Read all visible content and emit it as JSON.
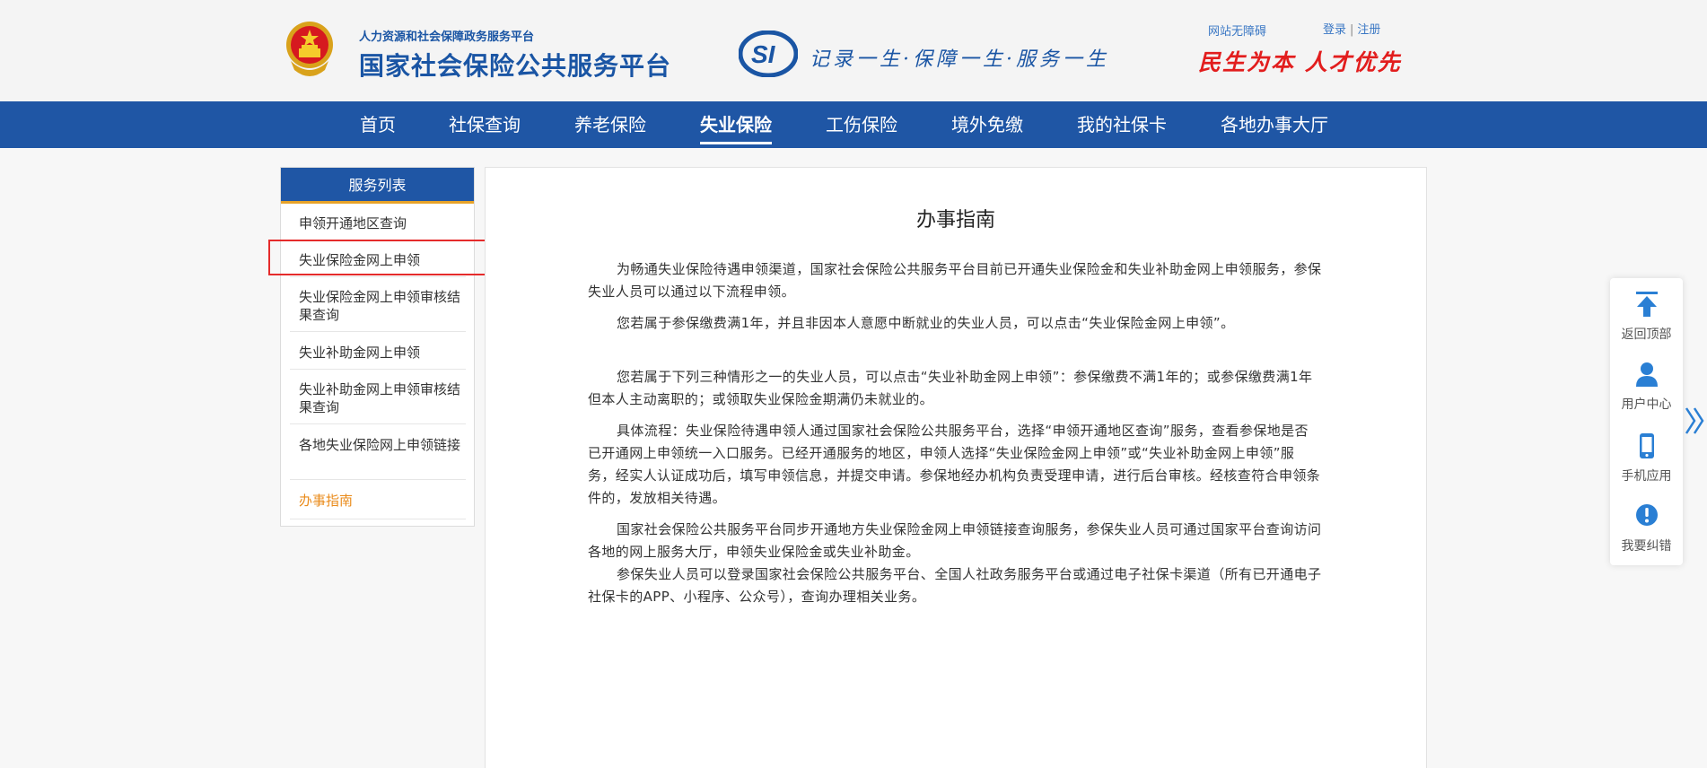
{
  "header": {
    "sub_title": "人力资源和社会保障政务服务平台",
    "title": "国家社会保险公共服务平台",
    "slogan": "记录一生·保障一生·服务一生",
    "motto": "民生为本 人才优先",
    "accessibility": "网站无障碍",
    "login": "登录",
    "separator": "|",
    "register": "注册"
  },
  "nav": {
    "items": [
      {
        "label": "首页"
      },
      {
        "label": "社保查询"
      },
      {
        "label": "养老保险"
      },
      {
        "label": "失业保险"
      },
      {
        "label": "工伤保险"
      },
      {
        "label": "境外免缴"
      },
      {
        "label": "我的社保卡"
      },
      {
        "label": "各地办事大厅"
      }
    ],
    "active": "失业保险"
  },
  "sidebar": {
    "title": "服务列表",
    "items": [
      {
        "label": "申领开通地区查询"
      },
      {
        "label": "失业保险金网上申领"
      },
      {
        "label": "失业保险金网上申领审核结果查询"
      },
      {
        "label": "失业补助金网上申领"
      },
      {
        "label": "失业补助金网上申领审核结果查询"
      },
      {
        "label": "各地失业保险网上申领链接"
      },
      {
        "label": "办事指南"
      }
    ],
    "current": "办事指南"
  },
  "main": {
    "title": "办事指南",
    "paragraphs": [
      "为畅通失业保险待遇申领渠道，国家社会保险公共服务平台目前已开通失业保险金和失业补助金网上申领服务，参保失业人员可以通过以下流程申领。",
      "您若属于参保缴费满1年，并且非因本人意愿中断就业的失业人员，可以点击“失业保险金网上申领”。",
      "您若属于下列三种情形之一的失业人员，可以点击“失业补助金网上申领”：参保缴费不满1年的；或参保缴费满1年但本人主动离职的；或领取失业保险金期满仍未就业的。",
      "具体流程：失业保险待遇申领人通过国家社会保险公共服务平台，选择“申领开通地区查询”服务，查看参保地是否已开通网上申领统一入口服务。已经开通服务的地区，申领人选择“失业保险金网上申领”或“失业补助金网上申领”服务，经实人认证成功后，填写申领信息，并提交申请。参保地经办机构负责受理申请，进行后台审核。经核查符合申领条件的，发放相关待遇。",
      "国家社会保险公共服务平台同步开通地方失业保险金网上申领链接查询服务，参保失业人员可通过国家平台查询访问各地的网上服务大厅，申领失业保险金或失业补助金。",
      "参保失业人员可以登录国家社会保险公共服务平台、全国人社政务服务平台或通过电子社保卡渠道（所有已开通电子社保卡的APP、小程序、公众号），查询办理相关业务。"
    ]
  },
  "float_bar": {
    "items": [
      {
        "label": "返回顶部",
        "icon": "arrow-up-icon"
      },
      {
        "label": "用户中心",
        "icon": "user-icon"
      },
      {
        "label": "手机应用",
        "icon": "phone-icon"
      },
      {
        "label": "我要纠错",
        "icon": "exclamation-icon"
      }
    ],
    "toggle_icon": "double-chevron-right-icon"
  },
  "colors": {
    "brand_blue": "#1f56a5",
    "accent_orange": "#e7a32a",
    "motto_red": "#e21d1d",
    "highlight_red": "#e52b2b"
  }
}
